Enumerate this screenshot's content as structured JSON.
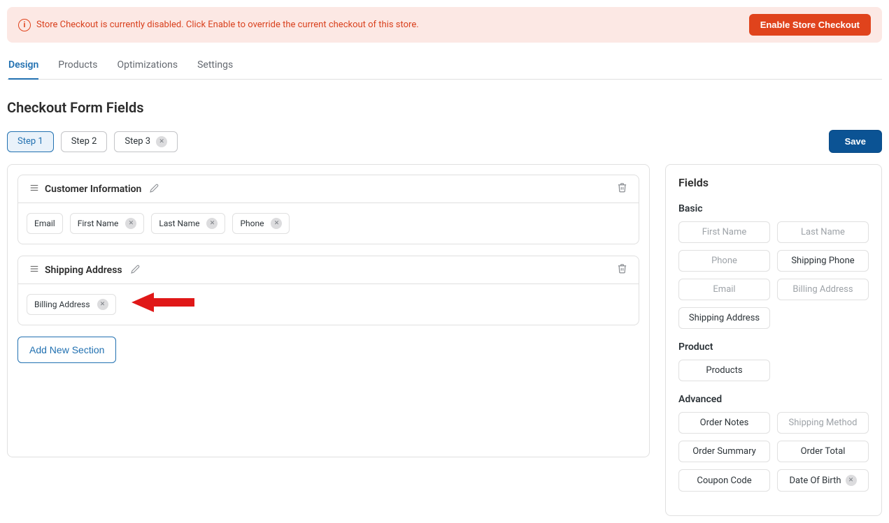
{
  "alert": {
    "message": "Store Checkout is currently disabled. Click Enable to override the current checkout of this store.",
    "button": "Enable Store Checkout"
  },
  "tabs": {
    "design": "Design",
    "products": "Products",
    "optimizations": "Optimizations",
    "settings": "Settings"
  },
  "page_title": "Checkout Form Fields",
  "steps": {
    "step1": "Step 1",
    "step2": "Step 2",
    "step3": "Step 3"
  },
  "save_button": "Save",
  "sections": {
    "customer": {
      "title": "Customer Information",
      "fields": {
        "email": "Email",
        "first_name": "First Name",
        "last_name": "Last Name",
        "phone": "Phone"
      }
    },
    "shipping": {
      "title": "Shipping Address",
      "fields": {
        "billing_address": "Billing Address"
      }
    }
  },
  "add_section": "Add New Section",
  "sidebar": {
    "title": "Fields",
    "groups": {
      "basic": {
        "label": "Basic",
        "fields": {
          "first_name": "First Name",
          "last_name": "Last Name",
          "phone": "Phone",
          "shipping_phone": "Shipping Phone",
          "email": "Email",
          "billing_address": "Billing Address",
          "shipping_address": "Shipping Address"
        }
      },
      "product": {
        "label": "Product",
        "fields": {
          "products": "Products"
        }
      },
      "advanced": {
        "label": "Advanced",
        "fields": {
          "order_notes": "Order Notes",
          "shipping_method": "Shipping Method",
          "order_summary": "Order Summary",
          "order_total": "Order Total",
          "coupon_code": "Coupon Code",
          "date_of_birth": "Date Of Birth"
        }
      }
    }
  }
}
